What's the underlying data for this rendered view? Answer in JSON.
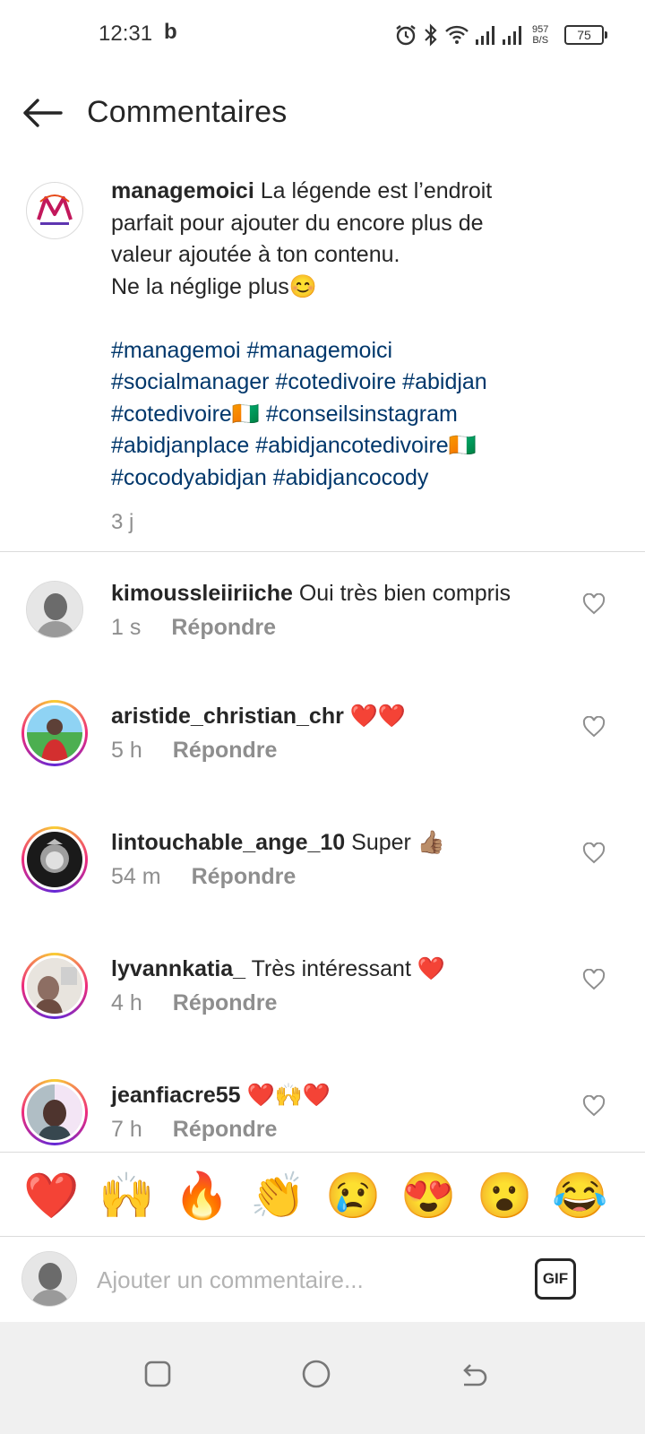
{
  "status_bar": {
    "time": "12:31",
    "bing_badge": "b",
    "net_speed_value": "957",
    "net_speed_unit": "B/S",
    "battery": "75"
  },
  "header": {
    "title": "Commentaires"
  },
  "caption": {
    "username": "managemoici",
    "text_lines": [
      "La légende est l’endroit",
      "parfait pour ajouter du encore plus de",
      "valeur ajoutée à ton contenu.",
      "Ne la néglige plus😊"
    ],
    "hashtag_lines": [
      "#managemoi #managemoici",
      "#socialmanager #cotedivoire #abidjan",
      "#cotedivoire🇨🇮 #conseilsinstagram",
      "#abidjanplace #abidjancotedivoire🇨🇮",
      "#cocodyabidjan #abidjancocody"
    ],
    "time": "3 j"
  },
  "comments": [
    {
      "username": "kimoussleiiriiche",
      "text": "Oui très bien compris",
      "time": "1 s",
      "reply": "Répondre"
    },
    {
      "username": "aristide_christian_chr",
      "text": "❤️❤️",
      "time": "5 h",
      "reply": "Répondre"
    },
    {
      "username": "lintouchable_ange_10",
      "text": "Super 👍🏽",
      "time": "54 m",
      "reply": "Répondre"
    },
    {
      "username": "lyvannkatia_",
      "text": "Très intéressant ❤️",
      "time": "4 h",
      "reply": "Répondre"
    },
    {
      "username": "jeanfiacre55",
      "text": "❤️🙌❤️",
      "time": "7 h",
      "reply": "Répondre"
    }
  ],
  "emoji_bar": [
    "❤️",
    "🙌",
    "🔥",
    "👏",
    "😢",
    "😍",
    "😮",
    "😂"
  ],
  "input": {
    "placeholder": "Ajouter un commentaire...",
    "gif_label": "GIF"
  },
  "colors": {
    "hashtag": "#00376b",
    "secondary_text": "#8e8e8e",
    "divider": "#dbdbdb",
    "story_ring": "#ee2a7b"
  }
}
